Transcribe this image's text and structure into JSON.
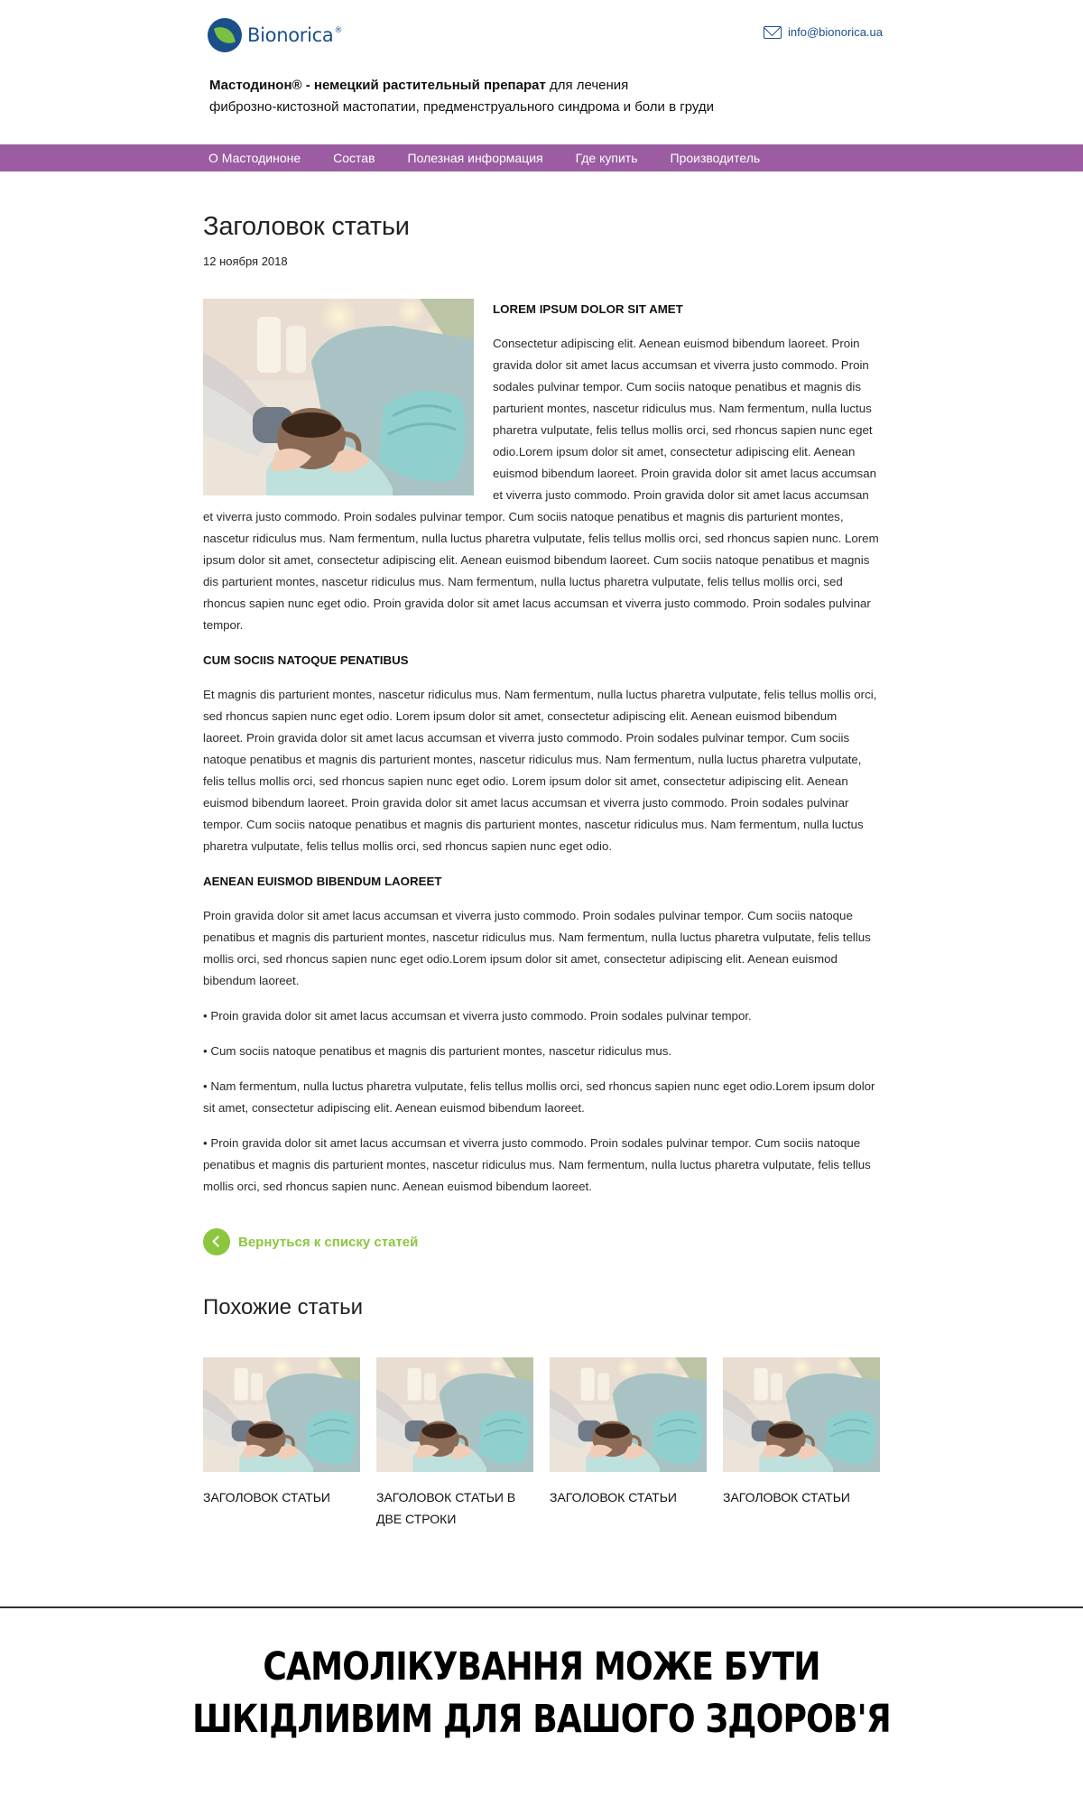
{
  "header": {
    "logo_text": "Bionorica",
    "logo_reg": "®",
    "email": "info@bionorica.ua",
    "tagline_bold": "Мастодинон®  - немецкий растительный препарат",
    "tagline_rest_line1": " для лечения",
    "tagline_line2": "фиброзно-кистозной мастопатии, предменструального синдрома и боли в груди"
  },
  "nav": {
    "items": [
      "О Мастодиноне",
      "Состав",
      "Полезная информация",
      "Где купить",
      "Производитель"
    ]
  },
  "article": {
    "title": "Заголовок статьи",
    "date": "12 ноября 2018",
    "heading1": "LOREM IPSUM DOLOR SIT AMET",
    "paragraph1": "Consectetur adipiscing elit. Aenean euismod bibendum laoreet. Proin gravida dolor sit amet lacus accumsan et viverra justo commodo. Proin sodales pulvinar tempor. Cum sociis natoque penatibus et magnis dis parturient montes, nascetur ridiculus mus. Nam fermentum, nulla luctus pharetra vulputate, felis tellus mollis orci, sed rhoncus sapien nunc eget odio.Lorem ipsum dolor sit amet, consectetur adipiscing elit. Aenean euismod bibendum laoreet. Proin gravida dolor sit amet lacus accumsan et viverra justo commodo. Proin gravida dolor sit amet lacus accumsan et viverra justo commodo. Proin sodales pulvinar tempor. Cum sociis natoque penatibus et magnis dis parturient montes, nascetur ridiculus mus. Nam fermentum, nulla luctus pharetra vulputate, felis tellus mollis orci, sed rhoncus sapien nunc. Lorem ipsum dolor sit amet, consectetur adipiscing elit. Aenean euismod bibendum laoreet. Cum sociis natoque penatibus et magnis dis parturient montes, nascetur ridiculus mus. Nam fermentum, nulla luctus pharetra vulputate, felis tellus mollis orci, sed rhoncus sapien nunc eget odio. Proin gravida dolor sit amet lacus accumsan et viverra justo commodo. Proin sodales pulvinar tempor.",
    "heading2": "CUM SOCIIS NATOQUE PENATIBUS",
    "paragraph2": "Et magnis dis parturient montes, nascetur ridiculus mus. Nam fermentum, nulla luctus pharetra vulputate, felis tellus mollis orci, sed rhoncus sapien nunc eget odio. Lorem ipsum dolor sit amet, consectetur adipiscing elit. Aenean euismod bibendum laoreet. Proin gravida dolor sit amet lacus accumsan et viverra justo commodo. Proin sodales pulvinar tempor. Cum sociis natoque penatibus et magnis dis parturient montes, nascetur ridiculus mus. Nam fermentum, nulla luctus pharetra vulputate, felis tellus mollis orci, sed rhoncus sapien nunc eget odio. Lorem ipsum dolor sit amet, consectetur adipiscing elit. Aenean euismod bibendum laoreet. Proin gravida dolor sit amet lacus accumsan et viverra justo commodo. Proin sodales pulvinar tempor. Cum sociis natoque penatibus et magnis dis parturient montes, nascetur ridiculus mus. Nam fermentum, nulla luctus pharetra vulputate, felis tellus mollis orci, sed rhoncus sapien nunc eget odio.",
    "heading3": "AENEAN EUISMOD BIBENDUM LAOREET",
    "paragraph3": "Proin gravida dolor sit amet lacus accumsan et viverra justo commodo. Proin sodales pulvinar tempor. Cum sociis natoque penatibus et magnis dis parturient montes, nascetur ridiculus mus. Nam fermentum, nulla luctus pharetra vulputate, felis tellus mollis orci, sed rhoncus sapien nunc eget odio.Lorem ipsum dolor sit amet, consectetur adipiscing elit. Aenean euismod bibendum laoreet.",
    "bullet1": "• Proin gravida dolor sit amet lacus accumsan et viverra justo commodo. Proin sodales pulvinar tempor.",
    "bullet2": "• Cum sociis natoque penatibus et magnis dis parturient montes, nascetur ridiculus mus.",
    "bullet3": "• Nam fermentum, nulla luctus pharetra vulputate, felis tellus mollis orci, sed rhoncus sapien nunc eget odio.Lorem ipsum dolor sit amet, consectetur adipiscing elit. Aenean euismod bibendum laoreet.",
    "bullet4": "• Proin gravida dolor sit amet lacus accumsan et viverra justo commodo. Proin sodales pulvinar tempor. Cum sociis natoque penatibus et magnis dis parturient montes, nascetur ridiculus mus. Nam fermentum, nulla luctus pharetra vulputate, felis tellus mollis orci, sed rhoncus sapien nunc. Aenean euismod bibendum laoreet.",
    "back_link": "Вернуться к списку статей"
  },
  "related": {
    "title": "Похожие статьи",
    "cards": [
      {
        "title": "Заголовок статьи"
      },
      {
        "title": "Заголовок статьи в две строки"
      },
      {
        "title": "Заголовок статьи"
      },
      {
        "title": "Заголовок статьи"
      }
    ]
  },
  "warning": {
    "line1": "САМОЛІКУВАННЯ МОЖЕ БУТИ",
    "line2": "ШКІДЛИВИМ ДЛЯ ВАШОГО ЗДОРОВ'Я"
  },
  "colors": {
    "nav_bg": "#9b5ca2",
    "brand_blue": "#1b4f8a",
    "accent_green": "#8cc63f"
  },
  "icons": {
    "logo": "leaf-logo-icon",
    "email": "envelope-icon",
    "back": "chevron-left-icon"
  }
}
